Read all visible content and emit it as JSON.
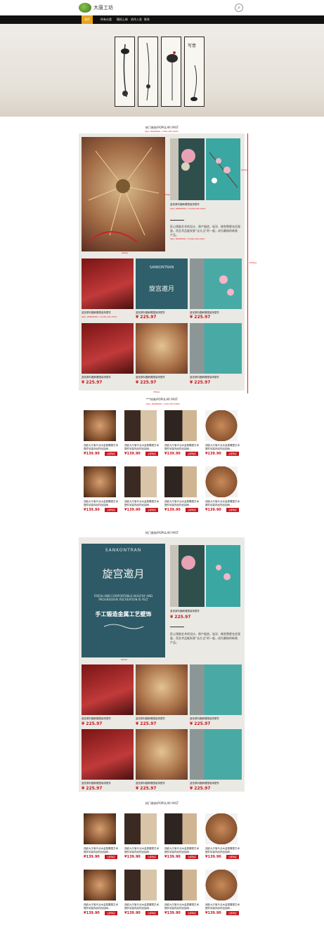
{
  "header": {
    "brand": "大唐工坊",
    "logo_icon": "leaf-logo-icon",
    "search_icon": "search-icon"
  },
  "nav": {
    "items": [
      "首页",
      "所有分类",
      "随机上新",
      "合作入驻",
      "联系"
    ]
  },
  "banner": {
    "slides": 4,
    "active": 1
  },
  "sections": {
    "hot1_title": "热门装饰/POPULAR PAST",
    "hot1_measure": "Stpo #666666 / 1920,283,2020",
    "hot2_title": "热门装饰/POPULAR PAST",
    "hot3_title": "热门装饰/POPULAR PAST"
  },
  "measures": {
    "m1": "600px",
    "m2": "580px",
    "m3": "250px",
    "m4": "1583px",
    "m5": "960px",
    "m6": "Stpo #f666666 / 1100,283,2800",
    "m7": "Stpo #666666 / 1200,283,2800"
  },
  "feature": {
    "caption": "蓝官原料圆刷雕塑装饰壁件",
    "measure_red": "Stpo #f666666 / 11160,205,2021",
    "desc": "匠心铸锻艺术的设计，原产锻造，轻洋、做到雪更名优观鉴，而艺术品能失致“长久当”的一般，成为最纳的新装产品。",
    "desc_measure": "Stpo #666666 / 11160,202,2021",
    "price": "¥ 225.97"
  },
  "grid": {
    "caption": "蓝官原料圆刷雕塑装饰壁件",
    "price": "¥ 225.97",
    "row_measure": "Stpo #f666666 / 11160,202,2021"
  },
  "popular": {
    "title": "***热装/POPULAR PAST",
    "title_measure": "Stpo #666666 / 1100,283,2800",
    "caption": "西欧大厅客代北木金属雕塑艺术摆件软装饰品样品抽雨...",
    "price": "¥139.90",
    "btn": "立即购买"
  },
  "feature2": {
    "brand_en": "SANKONTRAN",
    "title_cn": "旋宫邀月",
    "subtitle_en": "FRESH AND COMFORTABLE HEALTHY AND PROGRESSIVE RECREATION IS FELT",
    "tagline": "手工锻造金属工艺壁饰",
    "price": "¥ 225.97",
    "caption": "蓝官原料圆刷雕塑装饰壁件",
    "desc": "匠心铸锻艺术的设计，原产锻造，轻洋、做到雪更名优观鉴，而艺术品能失致“长久当”的一般，成为最纳的新装产品。"
  },
  "colors": {
    "accent": "#e8a21c",
    "price": "#c8161d",
    "nav_bg": "#111111",
    "measure": "#e02020"
  }
}
